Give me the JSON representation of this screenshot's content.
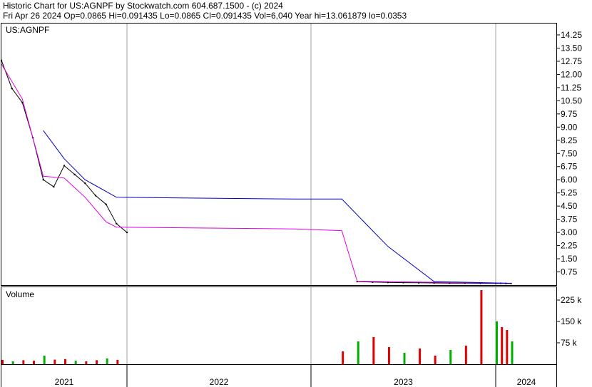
{
  "header": {
    "line1": "Historic Chart for US:AGNPF by Stockwatch.com 604.687.1500 - (c) 2024",
    "line2": "Fri Apr 26 2024   Op=0.0865   Hi=0.091435   Lo=0.0865   Cl=0.091435   Vol=6,040   Year hi=13.061879   lo=0.0353"
  },
  "price_panel": {
    "symbol_label": "US:AGNPF"
  },
  "volume_panel": {
    "label": "Volume"
  },
  "time_axis": {
    "years": [
      "2021",
      "2022",
      "2023",
      "2024"
    ]
  },
  "colors": {
    "price": "#000000",
    "ma_short": "#e000e0",
    "ma_long": "#0000c0",
    "vol_up": "#00b000",
    "vol_down": "#e00000",
    "grid": "#a0a0a0"
  },
  "chart_data": [
    {
      "type": "line",
      "title": "US:AGNPF",
      "y_ticks": [
        "14.25",
        "13.50",
        "12.75",
        "12.00",
        "11.25",
        "10.50",
        "9.75",
        "9.00",
        "8.25",
        "7.50",
        "6.75",
        "6.00",
        "5.25",
        "4.50",
        "3.75",
        "3.00",
        "2.25",
        "1.50",
        "0.75"
      ],
      "ylim": [
        0,
        14.9
      ],
      "x_ticks": [
        "2021",
        "2022",
        "2023",
        "2024"
      ],
      "series": [
        {
          "role": "price",
          "x": [
            "2021-01",
            "2021-02",
            "2021-03",
            "2021-04",
            "2021-05",
            "2021-06",
            "2021-07",
            "2021-08",
            "2021-09",
            "2021-10",
            "2021-11",
            "2021-12",
            "2022-01",
            "2022-02",
            "2022-03",
            "2022-04",
            "2022-05",
            "2022-06",
            "2022-07",
            "2022-08",
            "2022-09",
            "2022-10",
            "2022-11",
            "2022-12",
            "2023-01",
            "2023-02",
            "2023-03",
            "2023-04",
            "2023-05",
            "2023-06",
            "2023-07",
            "2023-08",
            "2023-09",
            "2023-10",
            "2023-11",
            "2023-12",
            "2024-01",
            "2024-02",
            "2024-03",
            "2024-04"
          ],
          "values": [
            12.8,
            11.2,
            10.4,
            8.4,
            6.0,
            5.6,
            6.8,
            6.3,
            5.8,
            5.1,
            4.6,
            3.5,
            3.0,
            null,
            null,
            null,
            null,
            null,
            null,
            null,
            null,
            null,
            null,
            null,
            null,
            null,
            null,
            0.2,
            0.17,
            0.15,
            0.14,
            0.13,
            0.12,
            0.11,
            0.11,
            0.1,
            0.1,
            0.1,
            0.095,
            0.09
          ]
        },
        {
          "role": "moving-average-short",
          "x": [
            "2021-01",
            "2021-03",
            "2021-05",
            "2021-07",
            "2021-09",
            "2021-11",
            "2021-12",
            "2022-12",
            "2023-03",
            "2023-04",
            "2024-04"
          ],
          "values": [
            12.6,
            10.6,
            6.2,
            6.1,
            5.0,
            3.6,
            3.3,
            3.2,
            3.1,
            0.22,
            0.1
          ]
        },
        {
          "role": "moving-average-long",
          "x": [
            "2021-05",
            "2021-07",
            "2021-09",
            "2021-12",
            "2022-12",
            "2023-03",
            "2023-06",
            "2023-09",
            "2024-04"
          ],
          "values": [
            8.8,
            7.2,
            6.0,
            5.0,
            4.9,
            4.9,
            2.2,
            0.2,
            0.1
          ]
        }
      ]
    },
    {
      "type": "bar",
      "title": "Volume",
      "y_ticks": [
        "225 k",
        "150 k",
        "75 k"
      ],
      "ylim": [
        0,
        270
      ],
      "x": [
        "2021-01",
        "2021-02",
        "2021-03",
        "2021-04",
        "2021-05",
        "2021-06",
        "2021-07",
        "2021-08",
        "2021-09",
        "2021-10",
        "2021-11",
        "2021-12",
        "2023-03",
        "2023-04",
        "2023-05",
        "2023-06",
        "2023-07",
        "2023-08",
        "2023-09",
        "2023-10",
        "2023-11",
        "2023-12",
        "2024-01",
        "2024-02",
        "2024-03",
        "2024-04"
      ],
      "values": [
        15,
        10,
        14,
        12,
        30,
        16,
        18,
        12,
        10,
        14,
        20,
        15,
        45,
        80,
        95,
        60,
        40,
        55,
        30,
        50,
        65,
        260,
        150,
        130,
        120,
        80
      ],
      "x_ticks": [
        "2021",
        "2022",
        "2023",
        "2024"
      ]
    }
  ]
}
